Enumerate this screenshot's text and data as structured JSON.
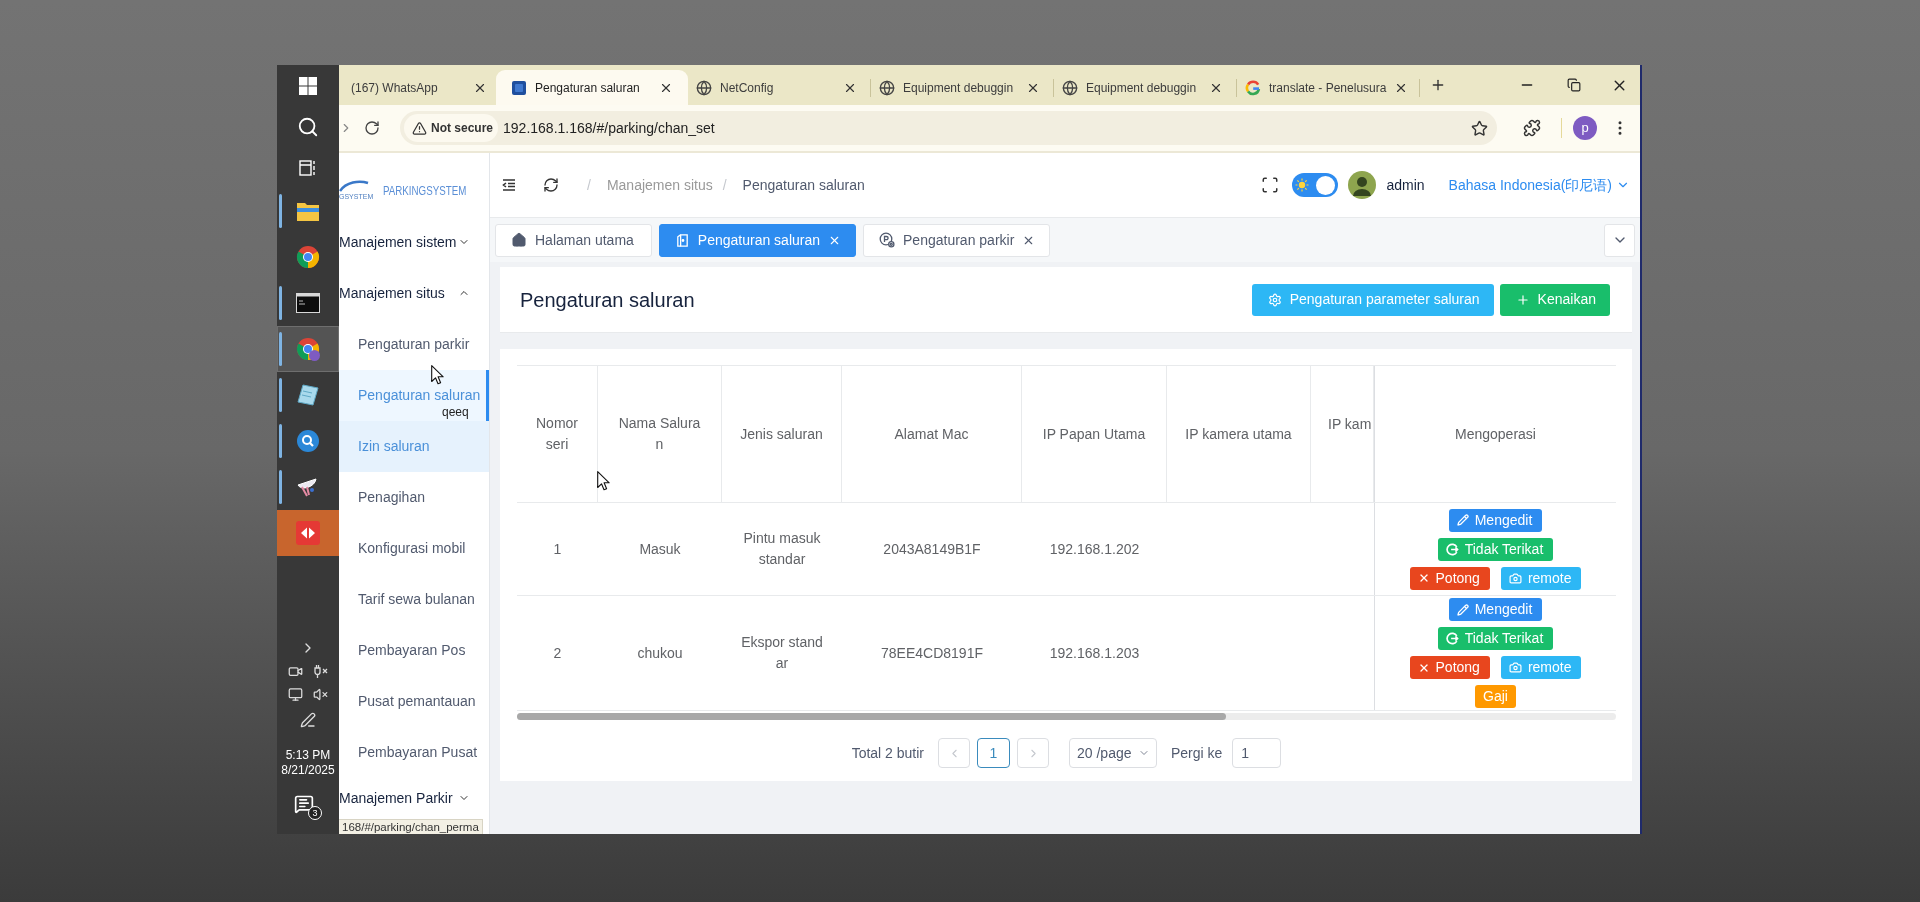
{
  "taskbar": {
    "apps": [
      {
        "kind": "windows",
        "running": false,
        "selected": false,
        "flashing": false
      },
      {
        "kind": "search",
        "running": false,
        "selected": false,
        "flashing": false
      },
      {
        "kind": "task-view",
        "running": false,
        "selected": false,
        "flashing": false
      },
      {
        "kind": "folder",
        "running": true,
        "selected": false,
        "flashing": false
      },
      {
        "kind": "chrome",
        "running": false,
        "selected": false,
        "flashing": false
      },
      {
        "kind": "terminal",
        "running": true,
        "selected": false,
        "flashing": false
      },
      {
        "kind": "chrome-profile",
        "running": true,
        "selected": true,
        "flashing": false
      },
      {
        "kind": "notepad",
        "running": true,
        "selected": false,
        "flashing": false
      },
      {
        "kind": "search-app",
        "running": true,
        "selected": false,
        "flashing": false
      },
      {
        "kind": "dish",
        "running": true,
        "selected": false,
        "flashing": false
      },
      {
        "kind": "remote-app",
        "running": false,
        "selected": false,
        "flashing": true
      }
    ],
    "time": "5:13 PM",
    "date": "8/21/2025",
    "notifications": "3"
  },
  "browser": {
    "tabs": [
      {
        "title": "(167) WhatsApp",
        "selected": false
      },
      {
        "title": "Pengaturan saluran",
        "kind": "parking",
        "selected": true
      },
      {
        "title": "NetConfig",
        "kind": "globe",
        "selected": false
      },
      {
        "title": "Equipment debuggin",
        "kind": "globe",
        "selected": false
      },
      {
        "title": "Equipment debuggin",
        "kind": "globe",
        "selected": false
      },
      {
        "title": "translate - Penelusura",
        "kind": "google",
        "selected": false
      }
    ],
    "security": "Not secure",
    "url": "192.168.1.168/#/parking/chan_set",
    "profile": "p",
    "status_url": "168/#/parking/chan_perma"
  },
  "sidebar": {
    "logo_caption": "GSYSTEM",
    "logo_text": "PARKINGSYSTEM",
    "items": [
      {
        "label": "Manajemen sistem",
        "expanded": false
      },
      {
        "label": "Manajemen situs",
        "expanded": true,
        "children": [
          {
            "label": "Pengaturan parkir",
            "selected": false,
            "hovered": false
          },
          {
            "label": "Pengaturan saluran",
            "selected": true,
            "hovered": false
          },
          {
            "label": "Izin saluran",
            "selected": false,
            "hovered": true
          },
          {
            "label": "Penagihan",
            "selected": false,
            "hovered": false
          },
          {
            "label": "Konfigurasi mobil",
            "selected": false,
            "hovered": false
          },
          {
            "label": "Tarif sewa bulanan",
            "selected": false,
            "hovered": false
          },
          {
            "label": "Pembayaran Pos",
            "selected": false,
            "hovered": false
          },
          {
            "label": "Pusat pemantauan",
            "selected": false,
            "hovered": false
          },
          {
            "label": "Pembayaran Pusat",
            "selected": false,
            "hovered": false
          }
        ]
      },
      {
        "label": "Manajemen Parkir",
        "expanded": false
      }
    ]
  },
  "tooltip": "qeeq",
  "header": {
    "separator": "/",
    "breadcrumb": [
      "Manajemen situs",
      "Pengaturan saluran"
    ],
    "theme_switch": {
      "on": true
    },
    "user": "admin",
    "language": "Bahasa Indonesia(印尼语)"
  },
  "page_tabs": [
    {
      "label": "Halaman utama",
      "kind": "home",
      "selected": false,
      "closable": false
    },
    {
      "label": "Pengaturan saluran",
      "kind": "door",
      "selected": true,
      "closable": true
    },
    {
      "label": "Pengaturan parkir",
      "kind": "parking-settings",
      "selected": false,
      "closable": true
    }
  ],
  "page": {
    "title": "Pengaturan saluran",
    "buttons": [
      {
        "label": "Pengaturan parameter saluran",
        "kind": "settings"
      },
      {
        "label": "Kenaikan",
        "kind": "add"
      }
    ]
  },
  "table": {
    "columns": [
      "Nomor seri",
      "Nama Saluran",
      "Jenis saluran",
      "Alamat Mac",
      "IP Papan Utama",
      "IP kamera utama",
      "IP kam"
    ],
    "action_column": "Mengoperasi",
    "rows": [
      {
        "cells": [
          "1",
          "Masuk",
          "Pintu masuk standar",
          "2043A8149B1F",
          "192.168.1.202"
        ],
        "actions": [
          {
            "label": "Mengedit",
            "kind": "edit"
          },
          {
            "label": "Tidak Terikat",
            "kind": "unbind"
          },
          {
            "label": "Potong",
            "kind": "cut"
          },
          {
            "label": "remote",
            "kind": "remote"
          }
        ]
      },
      {
        "cells": [
          "2",
          "chukou",
          "Ekspor standar",
          "78EE4CD8191F",
          "192.168.1.203"
        ],
        "actions": [
          {
            "label": "Mengedit",
            "kind": "edit"
          },
          {
            "label": "Tidak Terikat",
            "kind": "unbind"
          },
          {
            "label": "Potong",
            "kind": "cut"
          },
          {
            "label": "remote",
            "kind": "remote"
          },
          {
            "label": "Gaji",
            "kind": "pay"
          }
        ]
      }
    ]
  },
  "pagination": {
    "total": "Total 2 butir",
    "prev": {
      "disabled": true
    },
    "pages": [
      {
        "label": "1",
        "selected": true
      }
    ],
    "next": {
      "disabled": true
    },
    "page_size": "20 /page",
    "goto_label": "Pergi ke",
    "goto_value": "1"
  }
}
